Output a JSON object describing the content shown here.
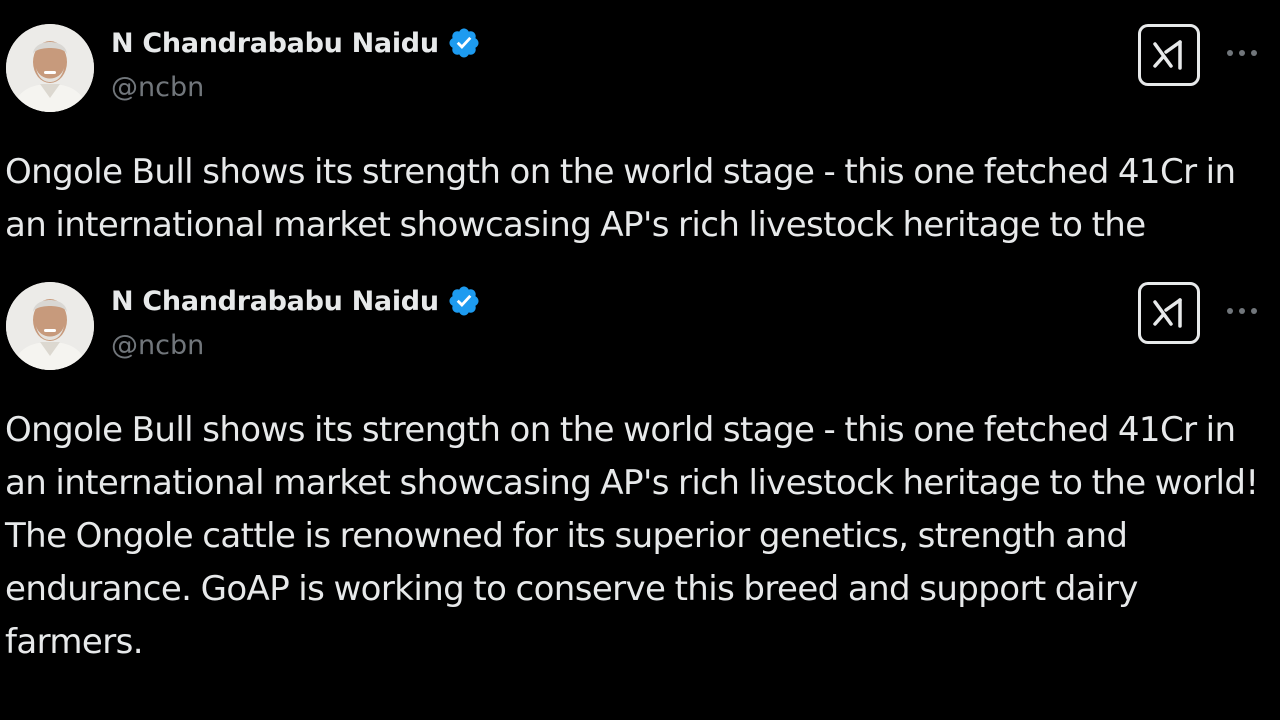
{
  "colors": {
    "background": "#000000",
    "text": "#e7e9ea",
    "handle": "#71767b",
    "verified_badge": "#1d9bf0"
  },
  "posts": [
    {
      "author": {
        "display_name": "N Chandrababu Naidu",
        "handle": "@ncbn",
        "verified": true,
        "avatar_icon": "profile-photo"
      },
      "grok_icon": "grok-icon",
      "more_icon": "more-options-icon",
      "more_label": "···",
      "text": "Ongole Bull shows its strength on the world stage - this one fetched 41Cr in an international market showcasing AP's rich livestock heritage to the"
    },
    {
      "author": {
        "display_name": "N Chandrababu Naidu",
        "handle": "@ncbn",
        "verified": true,
        "avatar_icon": "profile-photo"
      },
      "grok_icon": "grok-icon",
      "more_icon": "more-options-icon",
      "more_label": "···",
      "text": "Ongole Bull shows its strength on the world stage - this one fetched 41Cr in an international market showcasing AP's rich livestock heritage to the world! The Ongole cattle is renowned for its superior genetics, strength and endurance. GoAP is working to conserve this breed and support dairy farmers."
    }
  ]
}
